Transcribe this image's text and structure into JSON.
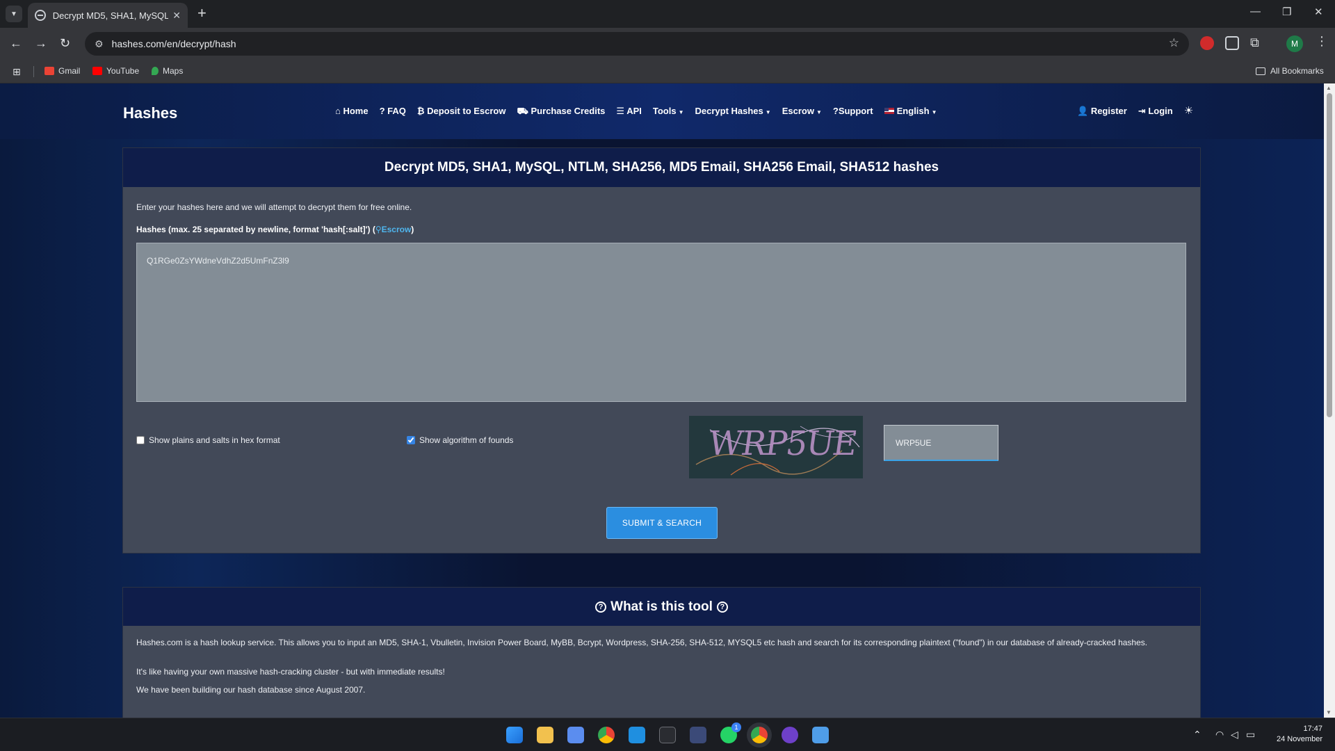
{
  "browser": {
    "tab_title": "Decrypt MD5, SHA1, MySQL, N",
    "url": "hashes.com/en/decrypt/hash",
    "profile_initial": "M",
    "bookmarks": [
      {
        "label": "Gmail",
        "icon": "gmail-icon",
        "color": "#ea4335"
      },
      {
        "label": "YouTube",
        "icon": "youtube-icon",
        "color": "#ff0000"
      },
      {
        "label": "Maps",
        "icon": "maps-icon",
        "color": "#34a853"
      }
    ],
    "all_bookmarks": "All Bookmarks"
  },
  "site": {
    "brand": "Hashes",
    "nav": [
      {
        "label": "Home",
        "icon": "home-icon"
      },
      {
        "label": "? FAQ",
        "icon": ""
      },
      {
        "label": "₿ Deposit to Escrow",
        "icon": ""
      },
      {
        "label": "Purchase Credits",
        "icon": "cart-icon"
      },
      {
        "label": "API",
        "icon": "list-icon"
      },
      {
        "label": "Tools",
        "icon": "",
        "dropdown": true
      },
      {
        "label": "Decrypt Hashes",
        "icon": "",
        "dropdown": true
      },
      {
        "label": "Escrow",
        "icon": "",
        "dropdown": true
      },
      {
        "label": "?Support",
        "icon": ""
      },
      {
        "label": "English",
        "icon": "us-flag-icon",
        "dropdown": true
      }
    ],
    "nav_right": [
      {
        "label": "Register",
        "icon": "user-plus-icon"
      },
      {
        "label": "Login",
        "icon": "sign-in-icon"
      }
    ]
  },
  "decrypt": {
    "heading": "Decrypt MD5, SHA1, MySQL, NTLM, SHA256, MD5 Email, SHA256 Email, SHA512 hashes",
    "intro": "Enter your hashes here and we will attempt to decrypt them for free online.",
    "label": "Hashes (max. 25 separated by newline, format 'hash[:salt]') (",
    "label_link": "Escrow",
    "label_close": ")",
    "hash_value": "Q1RGe0ZsYWdneVdhZ2d5UmFnZ3l9",
    "hex_label": "Show plains and salts in hex format",
    "hex_checked": false,
    "algo_label": "Show algorithm of founds",
    "algo_checked": true,
    "captcha_text": "WRP5UE",
    "captcha_value": "WRP5UE",
    "submit": "SUBMIT & SEARCH"
  },
  "about": {
    "heading": "What is this tool",
    "p1": "Hashes.com is a hash lookup service. This allows you to input an MD5, SHA-1, Vbulletin, Invision Power Board, MyBB, Bcrypt, Wordpress, SHA-256, SHA-512, MYSQL5 etc hash and search for its corresponding plaintext (\"found\") in our database of already-cracked hashes.",
    "p2": "It's like having your own massive hash-cracking cluster - but with immediate results!",
    "p3": "We have been building our hash database since August 2007."
  },
  "taskbar": {
    "time": "17:47",
    "date": "24 November",
    "whatsapp_badge": "1"
  }
}
